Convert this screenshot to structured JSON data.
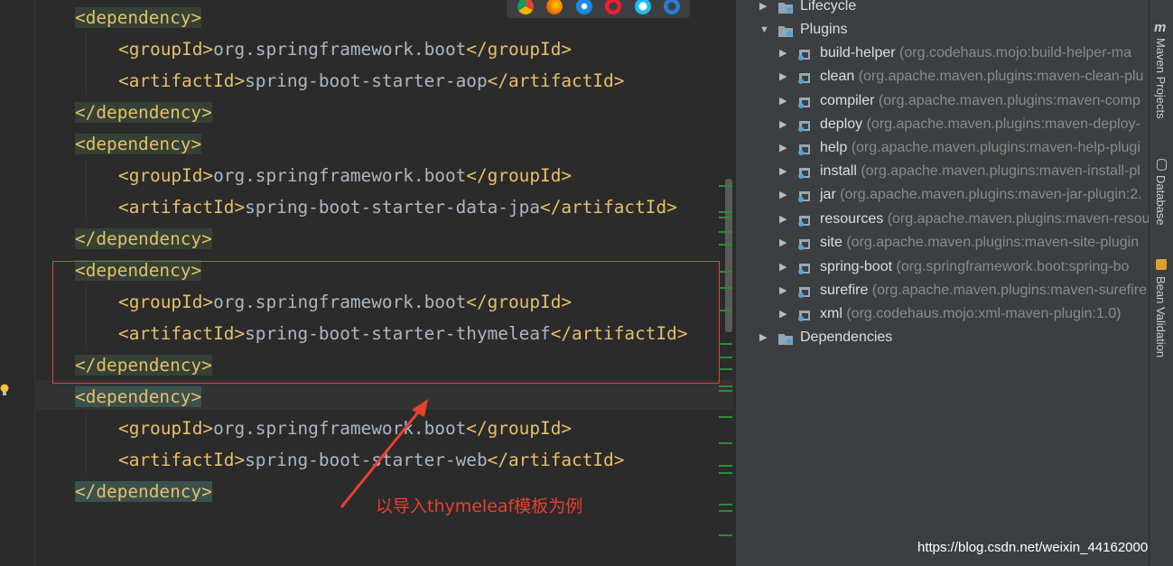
{
  "editor": {
    "lines": [
      {
        "open": "<",
        "name": "dependency",
        "close": ">",
        "text": "",
        "name2": "",
        "indent": 1,
        "hl": true
      },
      {
        "open": "<",
        "name": "groupId",
        "close": ">",
        "text": "org.springframework.boot",
        "name2": "groupId",
        "indent": 2
      },
      {
        "open": "<",
        "name": "artifactId",
        "close": ">",
        "text": "spring-boot-starter-aop",
        "name2": "artifactId",
        "indent": 2
      },
      {
        "open": "</",
        "name": "dependency",
        "close": ">",
        "text": "",
        "name2": "",
        "indent": 1,
        "hl": true
      },
      {
        "open": "<",
        "name": "dependency",
        "close": ">",
        "text": "",
        "name2": "",
        "indent": 1,
        "hl": true
      },
      {
        "open": "<",
        "name": "groupId",
        "close": ">",
        "text": "org.springframework.boot",
        "name2": "groupId",
        "indent": 2
      },
      {
        "open": "<",
        "name": "artifactId",
        "close": ">",
        "text": "spring-boot-starter-data-jpa",
        "name2": "artifactId",
        "indent": 2
      },
      {
        "open": "</",
        "name": "dependency",
        "close": ">",
        "text": "",
        "name2": "",
        "indent": 1,
        "hl": true
      },
      {
        "open": "<",
        "name": "dependency",
        "close": ">",
        "text": "",
        "name2": "",
        "indent": 1,
        "hl": true
      },
      {
        "open": "<",
        "name": "groupId",
        "close": ">",
        "text": "org.springframework.boot",
        "name2": "groupId",
        "indent": 2
      },
      {
        "open": "<",
        "name": "artifactId",
        "close": ">",
        "text": "spring-boot-starter-thymeleaf",
        "name2": "artifactId",
        "indent": 2
      },
      {
        "open": "</",
        "name": "dependency",
        "close": ">",
        "text": "",
        "name2": "",
        "indent": 1,
        "hl": true
      },
      {
        "open": "<",
        "name": "dependency",
        "close": ">",
        "text": "",
        "name2": "",
        "indent": 1,
        "hl": true,
        "hl2": true
      },
      {
        "open": "<",
        "name": "groupId",
        "close": ">",
        "text": "org.springframework.boot",
        "name2": "groupId",
        "indent": 2
      },
      {
        "open": "<",
        "name": "artifactId",
        "close": ">",
        "text": "spring-boot-starter-web",
        "name2": "artifactId",
        "indent": 2
      },
      {
        "open": "</",
        "name": "dependency",
        "close": ">",
        "text": "",
        "name2": "",
        "indent": 1,
        "hl": true,
        "hl2": true
      }
    ]
  },
  "annotation": {
    "text": "以导入thymeleaf模板为例",
    "color": "#e8402f"
  },
  "maven": {
    "tree": [
      {
        "label": "Lifecycle",
        "desc": "",
        "level": 0,
        "icon": "folder-gear-icon",
        "expanded": false
      },
      {
        "label": "Plugins",
        "desc": "",
        "level": 0,
        "icon": "folder-gear-icon",
        "expanded": true
      },
      {
        "label": "build-helper",
        "desc": " (org.codehaus.mojo:build-helper-ma",
        "level": 1,
        "icon": "maven-plugin-icon"
      },
      {
        "label": "clean",
        "desc": " (org.apache.maven.plugins:maven-clean-plu",
        "level": 1,
        "icon": "maven-plugin-icon"
      },
      {
        "label": "compiler",
        "desc": " (org.apache.maven.plugins:maven-comp",
        "level": 1,
        "icon": "maven-plugin-icon"
      },
      {
        "label": "deploy",
        "desc": " (org.apache.maven.plugins:maven-deploy-",
        "level": 1,
        "icon": "maven-plugin-icon"
      },
      {
        "label": "help",
        "desc": " (org.apache.maven.plugins:maven-help-plugi",
        "level": 1,
        "icon": "maven-plugin-icon"
      },
      {
        "label": "install",
        "desc": " (org.apache.maven.plugins:maven-install-pl",
        "level": 1,
        "icon": "maven-plugin-icon"
      },
      {
        "label": "jar",
        "desc": " (org.apache.maven.plugins:maven-jar-plugin:2.",
        "level": 1,
        "icon": "maven-plugin-icon"
      },
      {
        "label": "resources",
        "desc": " (org.apache.maven.plugins:maven-resou",
        "level": 1,
        "icon": "maven-plugin-icon"
      },
      {
        "label": "site",
        "desc": " (org.apache.maven.plugins:maven-site-plugin",
        "level": 1,
        "icon": "maven-plugin-icon"
      },
      {
        "label": "spring-boot",
        "desc": " (org.springframework.boot:spring-bo",
        "level": 1,
        "icon": "maven-plugin-icon"
      },
      {
        "label": "surefire",
        "desc": " (org.apache.maven.plugins:maven-surefire",
        "level": 1,
        "icon": "maven-plugin-icon"
      },
      {
        "label": "xml",
        "desc": " (org.codehaus.mojo:xml-maven-plugin:1.0)",
        "level": 1,
        "icon": "maven-plugin-icon"
      },
      {
        "label": "Dependencies",
        "desc": "",
        "level": 0,
        "icon": "dependencies-icon",
        "expanded": false
      }
    ]
  },
  "right_tabs": [
    "Maven Projects",
    "Database",
    "Bean Validation"
  ],
  "watermark": "https://blog.csdn.net/weixin_44162000",
  "colors": {
    "tag": "#e8bf6a",
    "text": "#a9b7c6",
    "box": "#e0403a",
    "bg": "#2b2b2b",
    "panel": "#3c3f41"
  }
}
